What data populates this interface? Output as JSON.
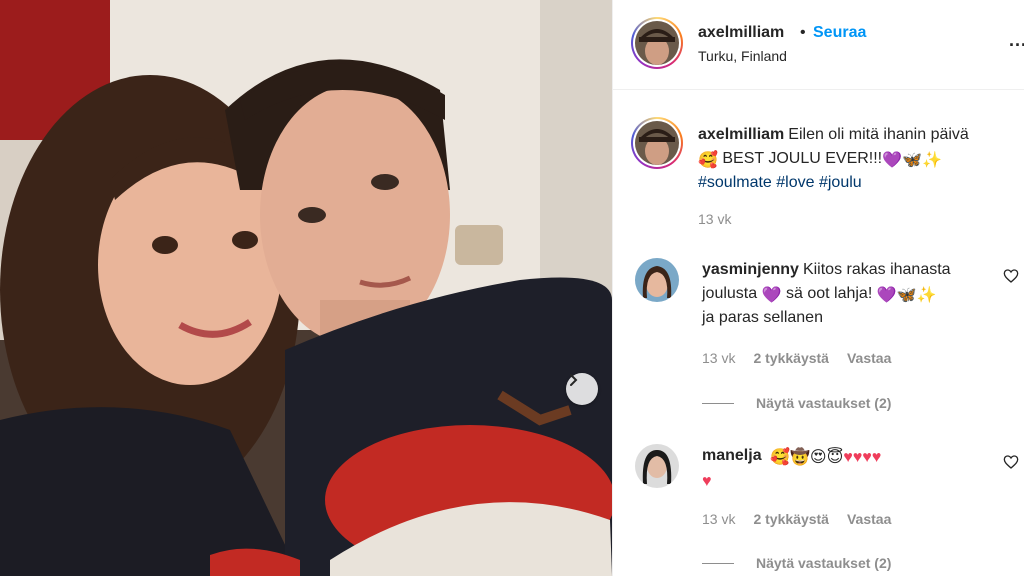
{
  "post": {
    "author": "axelmilliam",
    "follow_label": "Seuraa",
    "separator": "•",
    "location": "Turku, Finland",
    "more_label": "..."
  },
  "caption": {
    "username": "axelmilliam",
    "text": "Eilen oli mitä ihanin päivä",
    "text2": "BEST JOULU EVER!!!",
    "hashtags": "#soulmate #love #joulu",
    "time": "13 vk"
  },
  "comments": [
    {
      "username": "yasminjenny",
      "text_a": "Kiitos rakas ihanasta",
      "text_b": "joulusta",
      "text_c": "sä oot lahja!",
      "text_d": "ja paras sellanen",
      "time": "13 vk",
      "likes": "2 tykkäystä",
      "reply_label": "Vastaa",
      "view_replies": "Näytä vastaukset (2)"
    },
    {
      "username": "manelja",
      "time": "13 vk",
      "likes": "2 tykkäystä",
      "reply_label": "Vastaa",
      "view_replies": "Näytä vastaukset (2)"
    }
  ],
  "colors": {
    "link_blue": "#0095f6",
    "hashtag": "#00376b",
    "muted": "#8e8e8e"
  },
  "icons": [
    "carousel-next-icon",
    "more-options-icon",
    "heart-outline-icon"
  ]
}
